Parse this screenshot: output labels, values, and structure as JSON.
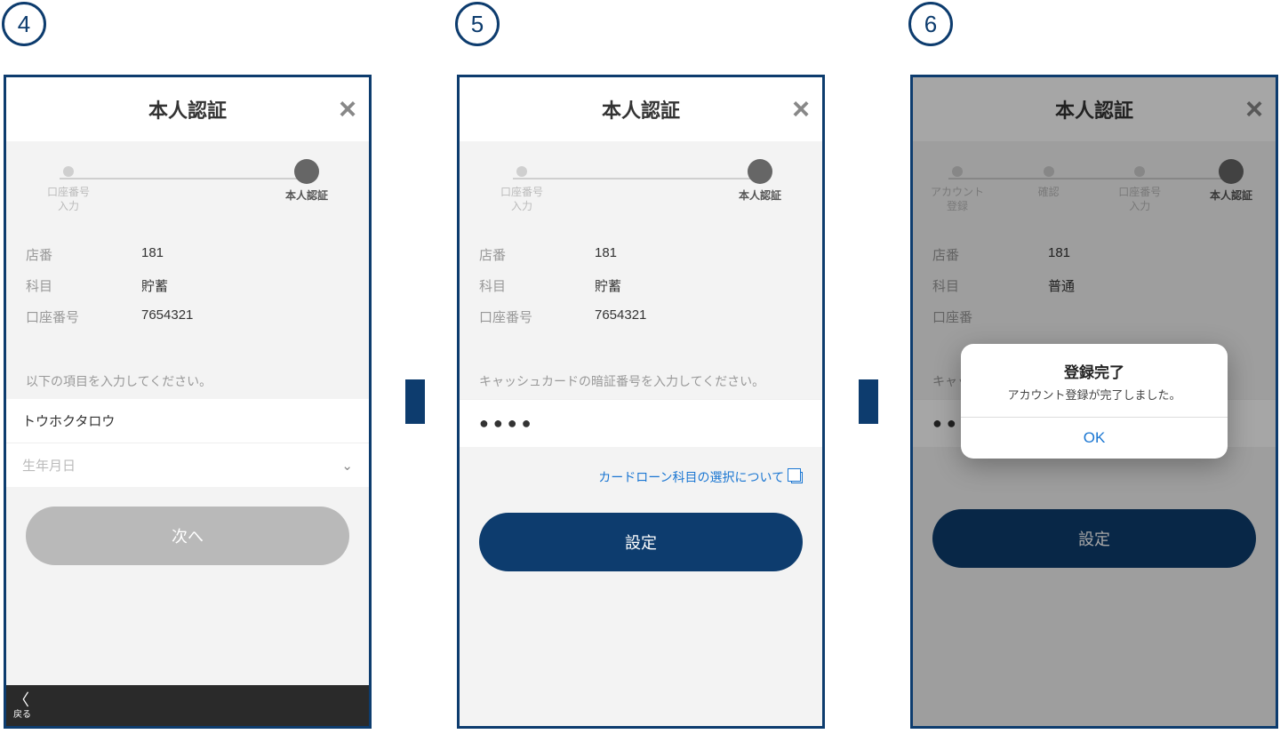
{
  "badges": {
    "b4": "4",
    "b5": "5",
    "b6": "6"
  },
  "common": {
    "title": "本人認証",
    "close_aria": "×"
  },
  "screen4": {
    "steps": [
      {
        "label": "口座番号\n入力",
        "active": false
      },
      {
        "label": "本人認証",
        "active": true
      }
    ],
    "info": {
      "branch_label": "店番",
      "branch_value": "181",
      "type_label": "科目",
      "type_value": "貯蓄",
      "acct_label": "口座番号",
      "acct_value": "7654321"
    },
    "instruction": "以下の項目を入力してください。",
    "name_value": "トウホクタロウ",
    "dob_placeholder": "生年月日",
    "btn": "次へ",
    "back": "戻る"
  },
  "screen5": {
    "steps": [
      {
        "label": "口座番号\n入力",
        "active": false
      },
      {
        "label": "本人認証",
        "active": true
      }
    ],
    "info": {
      "branch_label": "店番",
      "branch_value": "181",
      "type_label": "科目",
      "type_value": "貯蓄",
      "acct_label": "口座番号",
      "acct_value": "7654321"
    },
    "instruction": "キャッシュカードの暗証番号を入力してください。",
    "pin_masked": "●●●●",
    "link": "カードローン科目の選択について",
    "btn": "設定"
  },
  "screen6": {
    "steps": [
      {
        "label": "アカウント\n登録",
        "active": false
      },
      {
        "label": "確認",
        "active": false
      },
      {
        "label": "口座番号\n入力",
        "active": false
      },
      {
        "label": "本人認証",
        "active": true
      }
    ],
    "info": {
      "branch_label": "店番",
      "branch_value": "181",
      "type_label": "科目",
      "type_value": "普通",
      "acct_label": "口座番",
      "pin_label": "キャッ",
      "pin_masked": "●●●●"
    },
    "btn": "設定",
    "modal": {
      "title": "登録完了",
      "message": "アカウント登録が完了しました。",
      "ok": "OK"
    }
  }
}
